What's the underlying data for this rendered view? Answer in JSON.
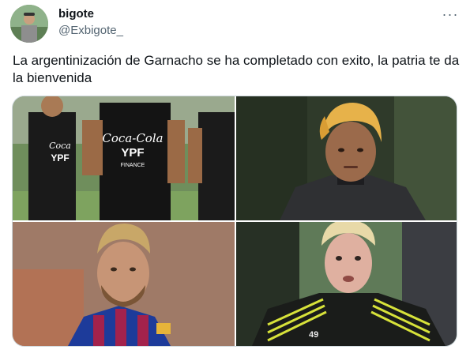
{
  "user": {
    "display_name": "bigote",
    "handle": "@Exbigote_",
    "avatar_icon": "profile-photo"
  },
  "menu": {
    "more_label": "···",
    "more_icon": "more-horizontal-icon"
  },
  "tweet": {
    "text": "La argentinización de Garnacho se ha completado con exito, la patria te da la bienvenida"
  },
  "media": {
    "photo_1": {
      "shirt_text": "Coca-Cola",
      "shirt_sponsor": "YPF",
      "shirt_sub": "FINANCE"
    },
    "photo_2": {},
    "photo_3": {},
    "photo_4": {
      "shirt_number": "49"
    }
  },
  "colors": {
    "text_primary": "#0f1419",
    "text_secondary": "#536471",
    "border": "#cfd9de"
  }
}
